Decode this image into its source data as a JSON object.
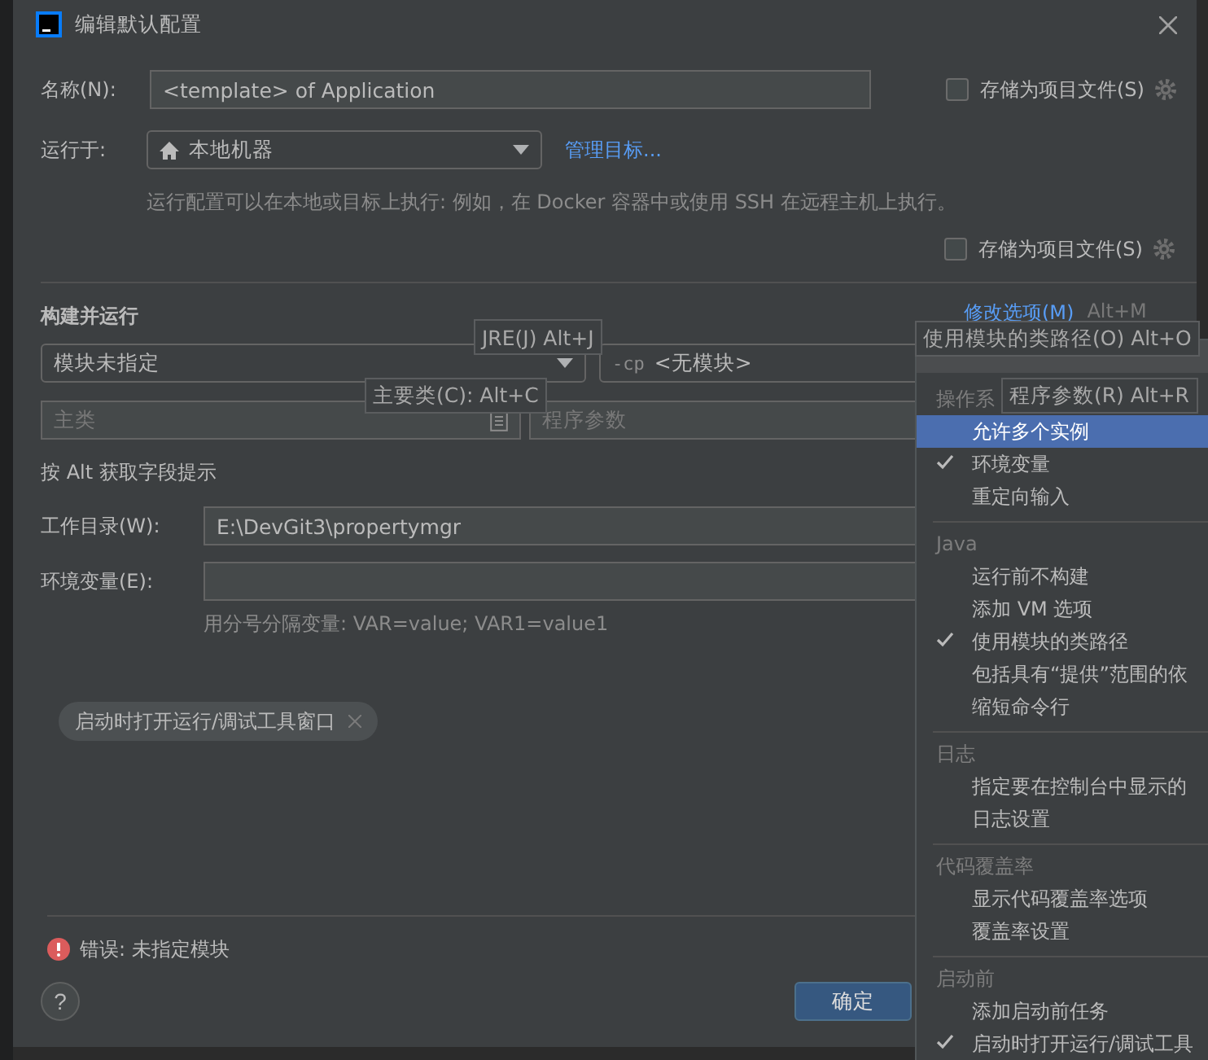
{
  "window": {
    "title": "编辑默认配置"
  },
  "name_row": {
    "label": "名称(N):",
    "value": "<template> of Application",
    "store": {
      "label": "存储为项目文件(S)",
      "checked": false
    }
  },
  "run_on": {
    "label": "运行于:",
    "value": "本地机器",
    "link": "管理目标...",
    "hint": "运行配置可以在本地或目标上执行: 例如，在 Docker 容器中或使用 SSH 在远程主机上执行。"
  },
  "store2": {
    "label": "存储为项目文件(S)",
    "checked": false
  },
  "section": {
    "title": "构建并运行",
    "modify": "修改选项(M)",
    "modify_shortcut": "Alt+M"
  },
  "module": {
    "value": "模块未指定",
    "cp_prefix": "-cp",
    "cp_value": "<无模块>"
  },
  "main_class": {
    "placeholder": "主类"
  },
  "args": {
    "placeholder": "程序参数"
  },
  "alt_hint": "按 Alt 获取字段提示",
  "workdir": {
    "label": "工作目录(W):",
    "value": "E:\\DevGit3\\propertymgr"
  },
  "env": {
    "label": "环境变量(E):",
    "hint": "用分号分隔变量: VAR=value; VAR1=value1"
  },
  "chips": [
    "启动时打开运行/调试工具窗口"
  ],
  "error": "错误: 未指定模块",
  "ok": "确定",
  "help": "?",
  "tooltips": [
    {
      "text": "JRE(J) Alt+J"
    },
    {
      "text": "使用模块的类路径(O) Alt+O"
    },
    {
      "text": "主要类(C): Alt+C"
    },
    {
      "text": "程序参数(R) Alt+R"
    }
  ],
  "popup": {
    "groups": [
      {
        "title": "操作系",
        "items": [
          {
            "label": "允许多个实例",
            "checked": false,
            "selected": true
          },
          {
            "label": "环境变量",
            "checked": true,
            "selected": false
          },
          {
            "label": "重定向输入",
            "checked": false,
            "selected": false
          }
        ]
      },
      {
        "title": "Java",
        "items": [
          {
            "label": "运行前不构建",
            "checked": false,
            "selected": false
          },
          {
            "label": "添加 VM 选项",
            "checked": false,
            "selected": false
          },
          {
            "label": "使用模块的类路径",
            "checked": true,
            "selected": false
          },
          {
            "label": "包括具有“提供”范围的依",
            "checked": false,
            "selected": false
          },
          {
            "label": "缩短命令行",
            "checked": false,
            "selected": false
          }
        ]
      },
      {
        "title": "日志",
        "items": [
          {
            "label": "指定要在控制台中显示的",
            "checked": false,
            "selected": false
          },
          {
            "label": "日志设置",
            "checked": false,
            "selected": false
          }
        ]
      },
      {
        "title": "代码覆盖率",
        "items": [
          {
            "label": "显示代码覆盖率选项",
            "checked": false,
            "selected": false
          },
          {
            "label": "覆盖率设置",
            "checked": false,
            "selected": false
          }
        ]
      },
      {
        "title": "启动前",
        "items": [
          {
            "label": "添加启动前任务",
            "checked": false,
            "selected": false
          },
          {
            "label": "启动时打开运行/调试工具",
            "checked": true,
            "selected": false
          }
        ]
      }
    ]
  }
}
